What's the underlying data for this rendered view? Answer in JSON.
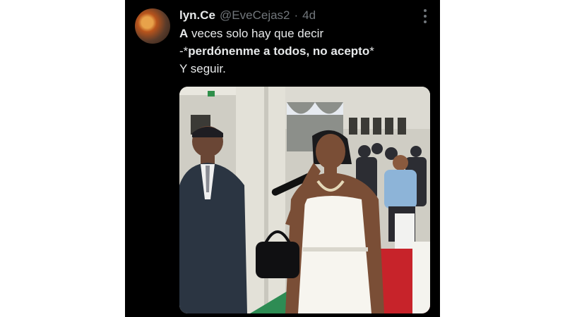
{
  "tweet": {
    "display_name": "lyn.Ce",
    "handle": "@EveCejas2",
    "separator": "·",
    "time": "4d",
    "lines": {
      "l1_bold": "A",
      "l1_rest": " veces solo hay que decir",
      "l2_prefix": "-*",
      "l2_bold": "perdónenme a todos, no acepto",
      "l2_suffix": "*",
      "l3": "Y seguir."
    }
  },
  "colors": {
    "background": "#000000",
    "primary_text": "#e7e9ea",
    "secondary_text": "#71767b"
  },
  "icons": {
    "more": "more-options-icon"
  }
}
